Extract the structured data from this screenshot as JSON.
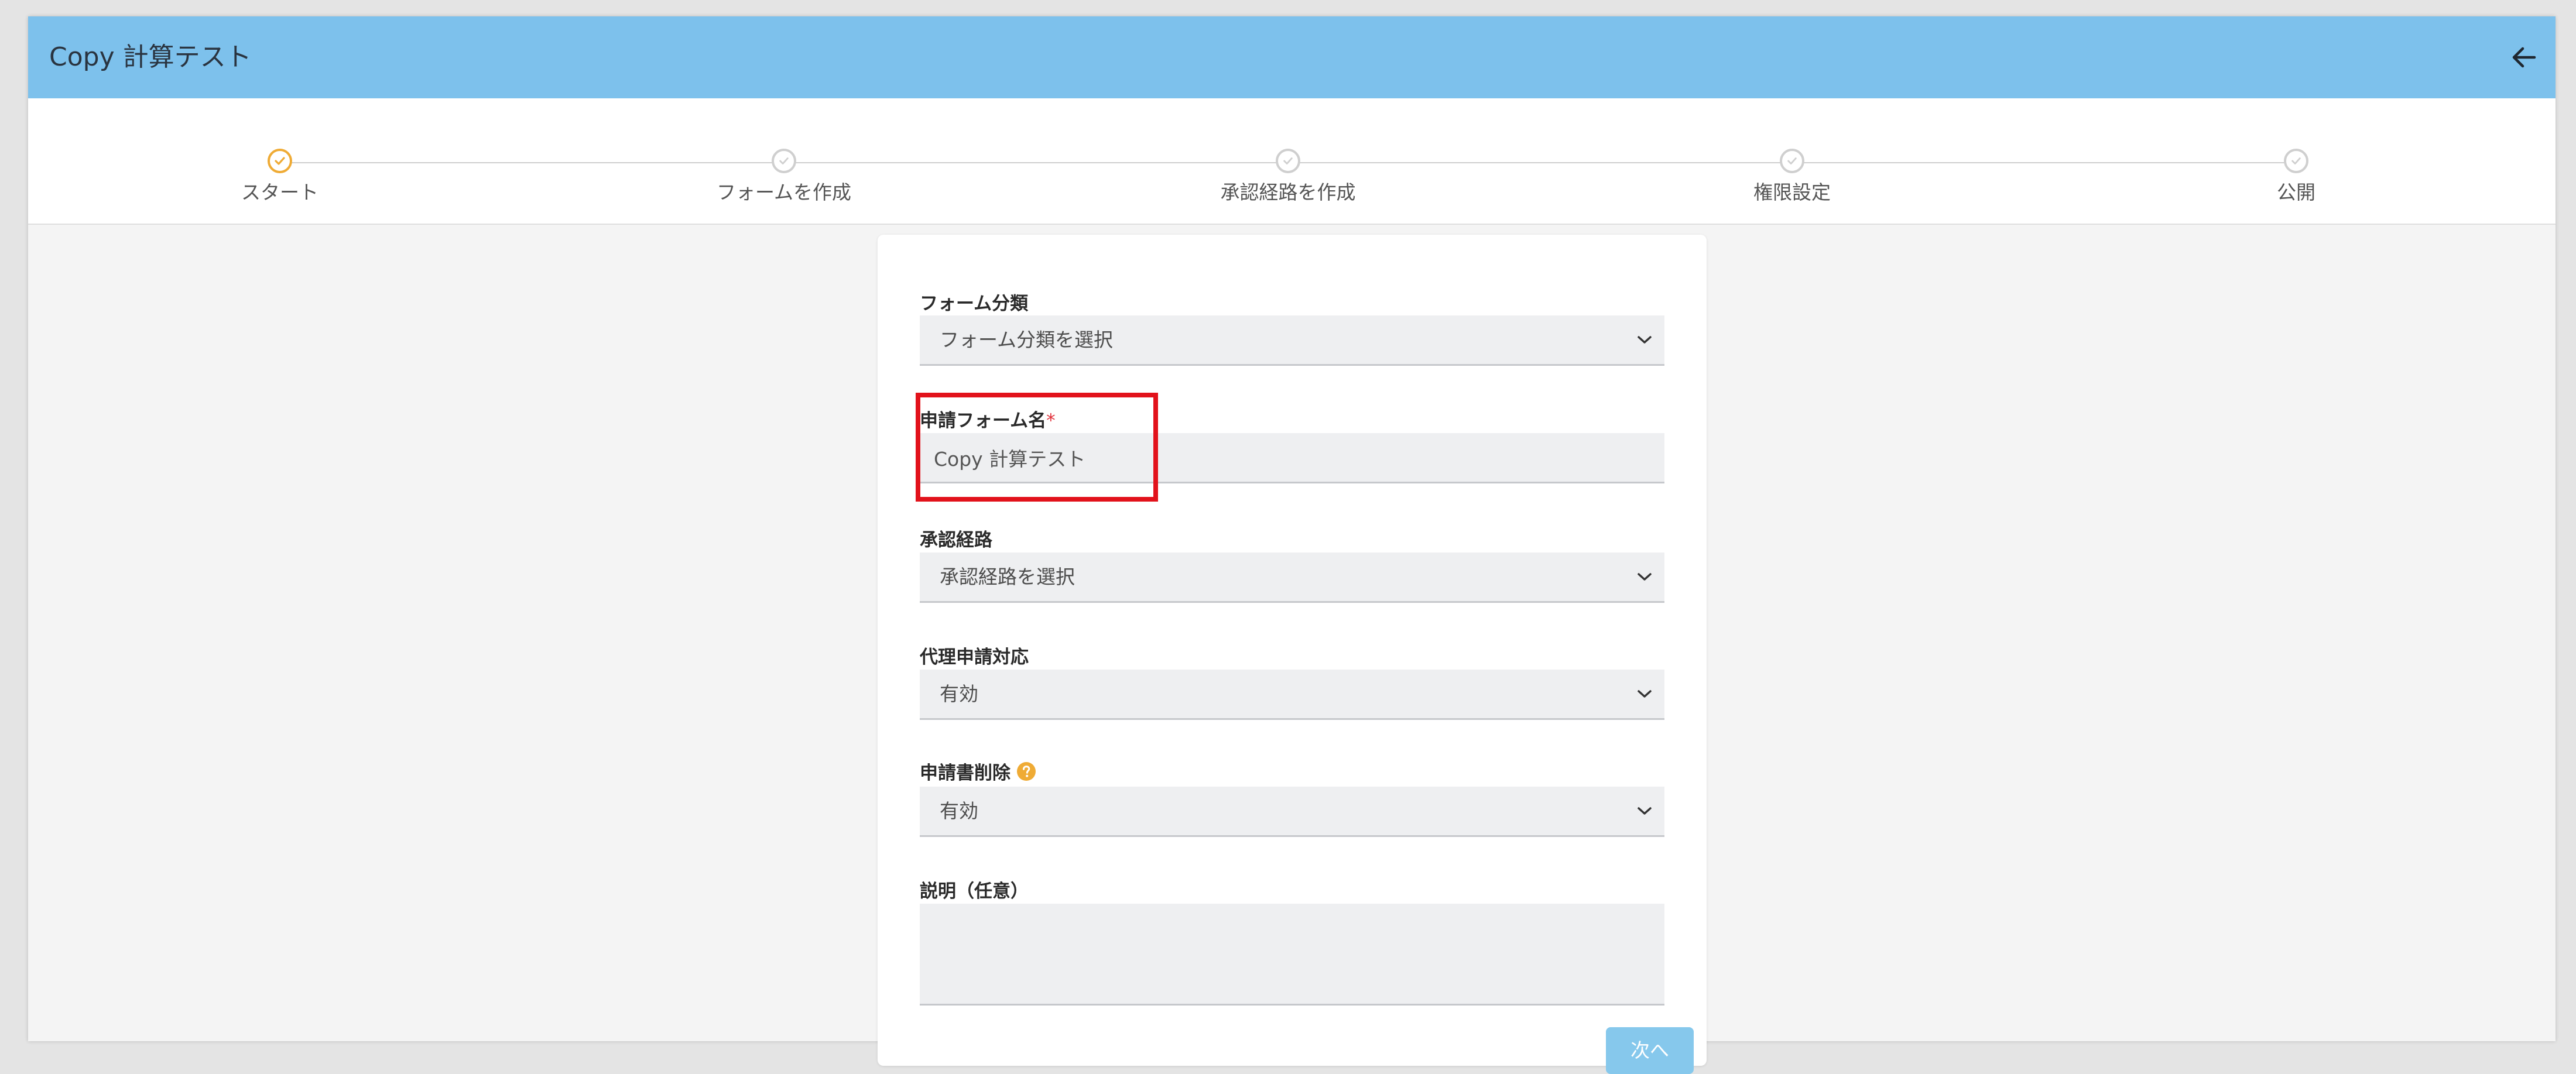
{
  "header": {
    "title": "Copy 計算テスト"
  },
  "steps": [
    {
      "label": "スタート",
      "state": "active"
    },
    {
      "label": "フォームを作成",
      "state": "inactive"
    },
    {
      "label": "承認経路を作成",
      "state": "inactive"
    },
    {
      "label": "権限設定",
      "state": "inactive"
    },
    {
      "label": "公開",
      "state": "inactive"
    }
  ],
  "form": {
    "category": {
      "label": "フォーム分類",
      "value": "フォーム分類を選択"
    },
    "form_name": {
      "label": "申請フォーム名",
      "required_mark": "*",
      "value": "Copy 計算テスト"
    },
    "approval_route": {
      "label": "承認経路",
      "value": "承認経路を選択"
    },
    "proxy_application": {
      "label": "代理申請対応",
      "value": "有効"
    },
    "application_deletion": {
      "label": "申請書削除",
      "value": "有効"
    },
    "description": {
      "label": "説明（任意）",
      "value": ""
    },
    "next_label": "次へ"
  },
  "colors": {
    "header_bg": "#7dc1ec",
    "active_step": "#efab35",
    "inactive_step": "#cfcfcf",
    "required": "#e2323c",
    "highlight": "#e2121b",
    "next_button": "#86c8ec"
  },
  "icons": {
    "back": "arrow-left-icon",
    "step_done": "check-icon",
    "select": "chevron-down-icon",
    "help": "question-circle-icon"
  }
}
